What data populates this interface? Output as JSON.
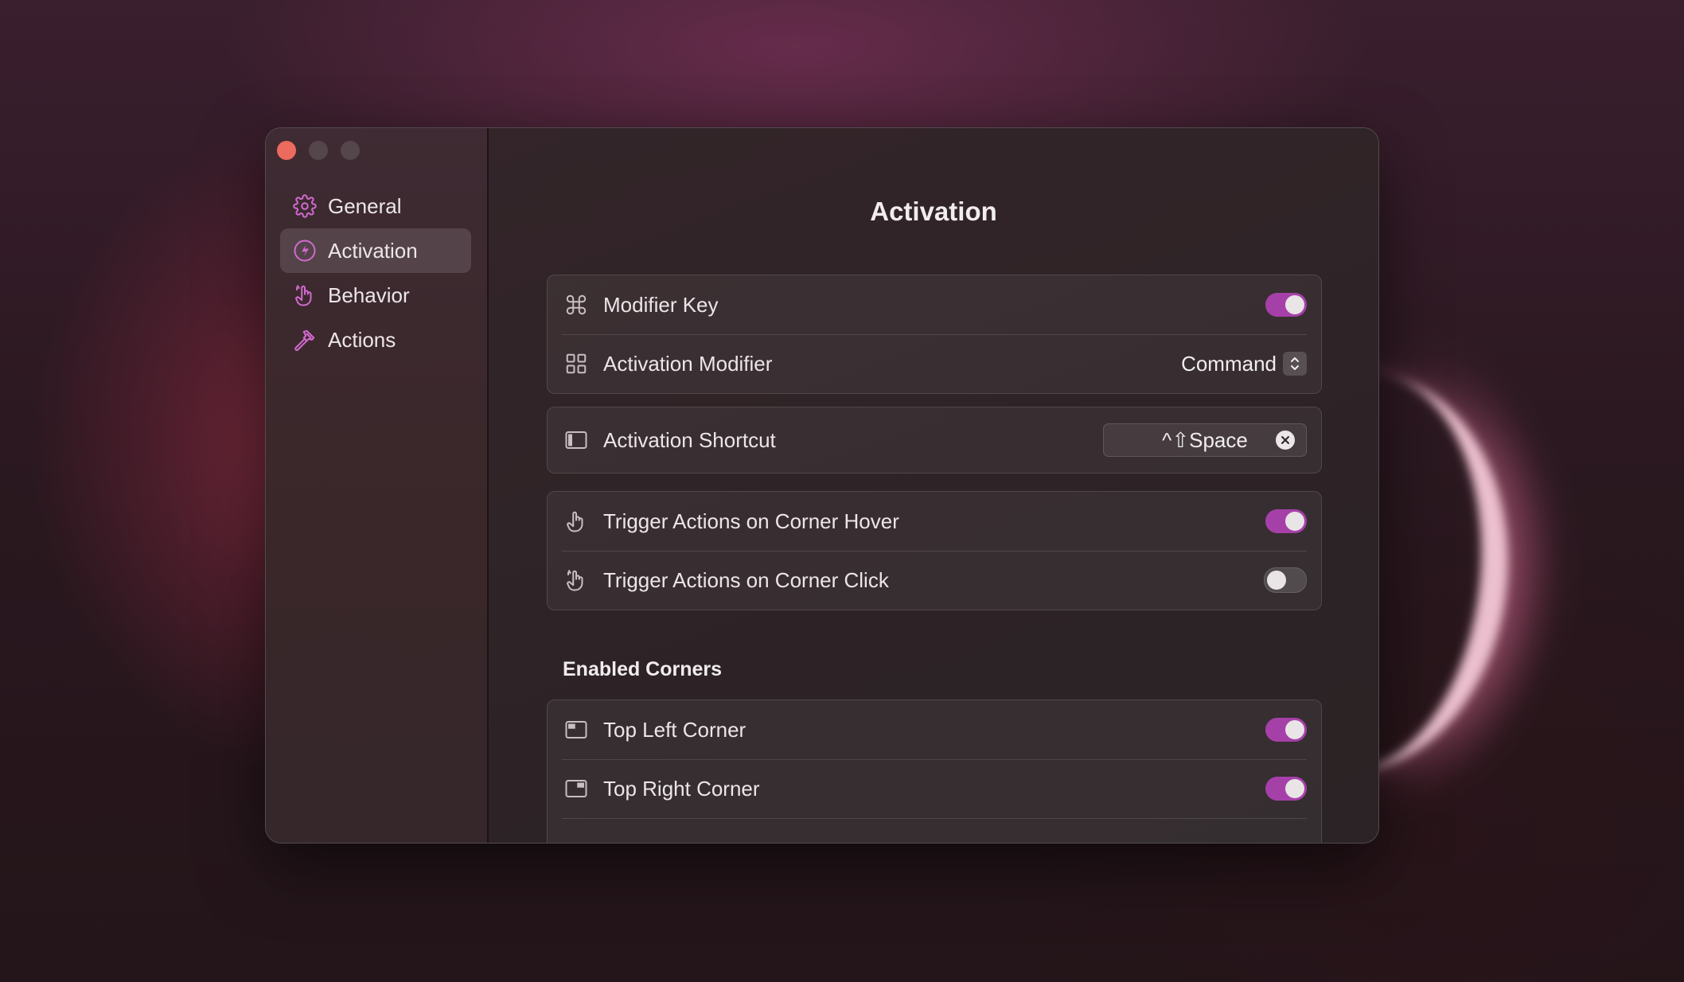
{
  "window": {
    "traffic_lights": [
      "close",
      "minimize",
      "maximize"
    ]
  },
  "sidebar": {
    "items": [
      {
        "label": "General",
        "icon": "gear-icon",
        "active": false
      },
      {
        "label": "Activation",
        "icon": "bolt-icon",
        "active": true
      },
      {
        "label": "Behavior",
        "icon": "hand-pointer-icon",
        "active": false
      },
      {
        "label": "Actions",
        "icon": "hammer-icon",
        "active": false
      }
    ]
  },
  "main": {
    "title": "Activation",
    "modifier_key": {
      "label": "Modifier Key",
      "icon": "command-icon",
      "enabled": true
    },
    "activation_modifier": {
      "label": "Activation Modifier",
      "icon": "grid-icon",
      "value": "Command"
    },
    "activation_shortcut": {
      "label": "Activation Shortcut",
      "icon": "sidebar-window-icon",
      "value": "^⇧Space"
    },
    "corner_hover": {
      "label": "Trigger Actions on Corner Hover",
      "icon": "hand-icon",
      "enabled": true
    },
    "corner_click": {
      "label": "Trigger Actions on Corner Click",
      "icon": "hand-tap-icon",
      "enabled": false
    },
    "enabled_corners_title": "Enabled Corners",
    "top_left": {
      "label": "Top Left Corner",
      "icon": "top-left-corner-icon",
      "enabled": true
    },
    "top_right": {
      "label": "Top Right Corner",
      "icon": "top-right-corner-icon",
      "enabled": true
    }
  },
  "colors": {
    "accent": "#a640a9",
    "close": "#ec6a5e",
    "sidebar_icon": "#d26ad0"
  }
}
